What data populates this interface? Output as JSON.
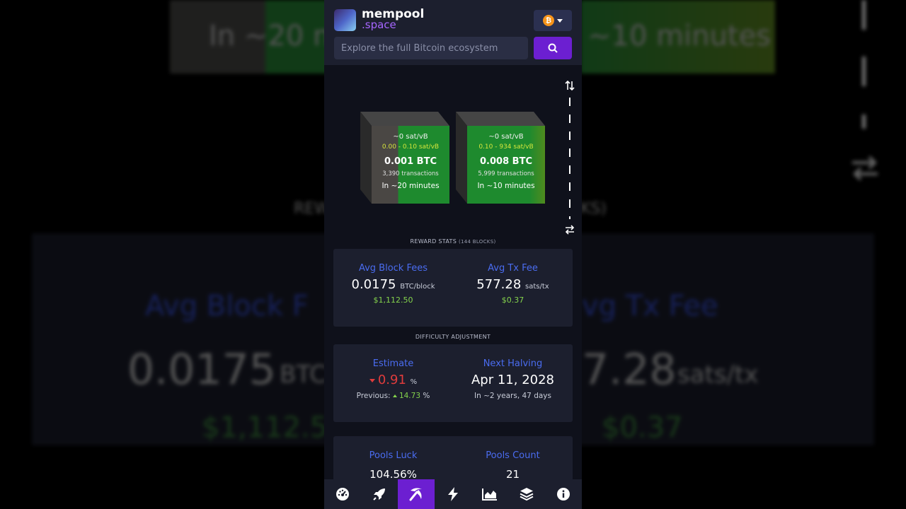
{
  "background_echo": {
    "top_left_text": "In ~20 m",
    "top_right_text": "~10 minutes",
    "mid_left_text": "REW",
    "mid_right_text": "KS)",
    "stat_left_label": "Avg Block F",
    "stat_right_label": "vg Tx Fee",
    "value_left": "0.0175",
    "unit_left": "BTC",
    "value_right": "7.28",
    "unit_right": "sats/tx",
    "fiat_left": "$1,112.50",
    "fiat_right": "$0.37"
  },
  "header": {
    "logo_line1": "mempool",
    "logo_line2": ".space",
    "network_symbol": "₿",
    "search_placeholder": "Explore the full Bitcoin ecosystem"
  },
  "blocks": [
    {
      "median_fee": "~0 sat/vB",
      "fee_range": "0.00 - 0.10 sat/vB",
      "total": "0.001 BTC",
      "tx_count": "3,390 transactions",
      "eta": "In ~20 minutes"
    },
    {
      "median_fee": "~0 sat/vB",
      "fee_range": "0.10 - 934 sat/vB",
      "total": "0.008 BTC",
      "tx_count": "5,999 transactions",
      "eta": "In ~10 minutes"
    }
  ],
  "reward_stats": {
    "title": "REWARD STATS",
    "subtitle": "(144 BLOCKS)",
    "avg_block_fees_label": "Avg Block Fees",
    "avg_block_fees_value": "0.0175",
    "avg_block_fees_unit": "BTC/block",
    "avg_block_fees_fiat": "$1,112.50",
    "avg_tx_fee_label": "Avg Tx Fee",
    "avg_tx_fee_value": "577.28",
    "avg_tx_fee_unit": "sats/tx",
    "avg_tx_fee_fiat": "$0.37"
  },
  "difficulty": {
    "title": "DIFFICULTY ADJUSTMENT",
    "estimate_label": "Estimate",
    "estimate_value": "0.91",
    "estimate_unit": "%",
    "previous_label": "Previous:",
    "previous_value": "14.73",
    "previous_unit": "%",
    "halving_label": "Next Halving",
    "halving_date": "Apr 11, 2028",
    "halving_eta": "In ~2 years, 47 days"
  },
  "pools": {
    "luck_label": "Pools Luck",
    "luck_value": "104.56%",
    "count_label": "Pools Count",
    "count_value": "21"
  },
  "nav": {
    "active_index": 2,
    "items": [
      "dashboard-icon",
      "rocket-icon",
      "pickaxe-icon",
      "lightning-icon",
      "chart-icon",
      "layers-icon",
      "info-icon"
    ]
  },
  "colors": {
    "accent": "#6c1fd1",
    "label_blue": "#4a6cf0",
    "fiat_green": "#84d34c",
    "negative_red": "#e03c3c",
    "block_green": "#1e8a2e"
  }
}
